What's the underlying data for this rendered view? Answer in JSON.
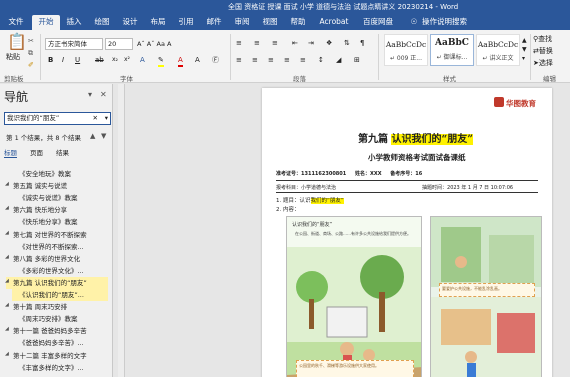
{
  "window": {
    "title": "全国 资格证 授课 面试 小学 道德与法治 试题点睛讲义 20230214  -  Word"
  },
  "menu": {
    "tabs": [
      "文件",
      "开始",
      "插入",
      "绘图",
      "设计",
      "布局",
      "引用",
      "邮件",
      "审阅",
      "视图",
      "帮助",
      "Acrobat",
      "百度网盘"
    ],
    "tell_me": "操作说明搜索"
  },
  "ribbon": {
    "paste": "粘贴",
    "clipboard_label": "剪贴板",
    "font_name": "方正书宋简体",
    "font_size": "20",
    "font_label": "字体",
    "paragraph_label": "段落",
    "styles_label": "样式",
    "styles": [
      {
        "sample": "AaBbCcDc",
        "name": "↵ 009 正..."
      },
      {
        "sample": "AaBbC",
        "name": "↵ 御课标..."
      },
      {
        "sample": "AaBbCcDc",
        "name": "↵ 讲义正文"
      }
    ],
    "find": "查找",
    "replace": "替换",
    "select": "选择",
    "editing_label": "编辑",
    "a_buttons": "Aˆ  Aˇ  Aa  A"
  },
  "nav": {
    "title": "导航",
    "search_value": "我识我们的“朋友”",
    "result_text": "第 1 个结果，共 8 个结果",
    "tabs": [
      "标题",
      "页面",
      "结果"
    ],
    "headings": [
      {
        "text": "《安全地玩》教案",
        "level": 2
      },
      {
        "text": "第五篇 诚实与说谎",
        "level": 1
      },
      {
        "text": "《诚实与说谎》教案",
        "level": 2
      },
      {
        "text": "第六篇 快乐地分享",
        "level": 1
      },
      {
        "text": "《快乐地分享》教案",
        "level": 2
      },
      {
        "text": "第七篇 对世界的不断探索",
        "level": 1
      },
      {
        "text": "《对世界的不断探索...",
        "level": 2
      },
      {
        "text": "第八篇 多彩的世界文化",
        "level": 1
      },
      {
        "text": "《多彩的世界文化》...",
        "level": 2
      },
      {
        "text": "第九篇 认识我们的“朋友”",
        "level": 1,
        "hl": true
      },
      {
        "text": "《认识我们的“朋友”...",
        "level": 2,
        "hl": true
      },
      {
        "text": "第十篇 周末巧安排",
        "level": 1
      },
      {
        "text": "《周末巧安排》教案",
        "level": 2
      },
      {
        "text": "第十一篇 爸爸妈妈多辛苦",
        "level": 1
      },
      {
        "text": "《爸爸妈妈多辛苦》...",
        "level": 2
      },
      {
        "text": "第十二篇 丰富多样的文字",
        "level": 1
      },
      {
        "text": "《丰富多样的文字》...",
        "level": 2
      }
    ]
  },
  "doc": {
    "logo": "华图教育",
    "heading_prefix": "第九篇",
    "heading_hl": "认识我们的“朋友”",
    "subheading": "小学教师资格考试面试备课纸",
    "exam_no_label": "准考证号：",
    "exam_no": "1311162300801",
    "name_label": "姓名：",
    "name": "XXX",
    "order_label": "备考序号：",
    "order": "16",
    "subject_label": "报考科目：",
    "subject": "小学道德与法治",
    "time_label": "抽题时间：",
    "time": "2023 年 1 月 7 日 10:07:06",
    "q1_prefix": "1. 题目：",
    "q1_plain": "认识",
    "q1_hl": "我们的“朋友”",
    "q2": "2. 内容：",
    "illus_title": "认识我们的“朋友”",
    "illus_text": "在公园、街道、商场、公路……有许多公共设施给我们提供方便。",
    "bubble1": "公园里的秋千、滑梯等游乐设施供大家使用。",
    "bubble2": "要爱护公共设施，不能乱涂乱画。"
  }
}
